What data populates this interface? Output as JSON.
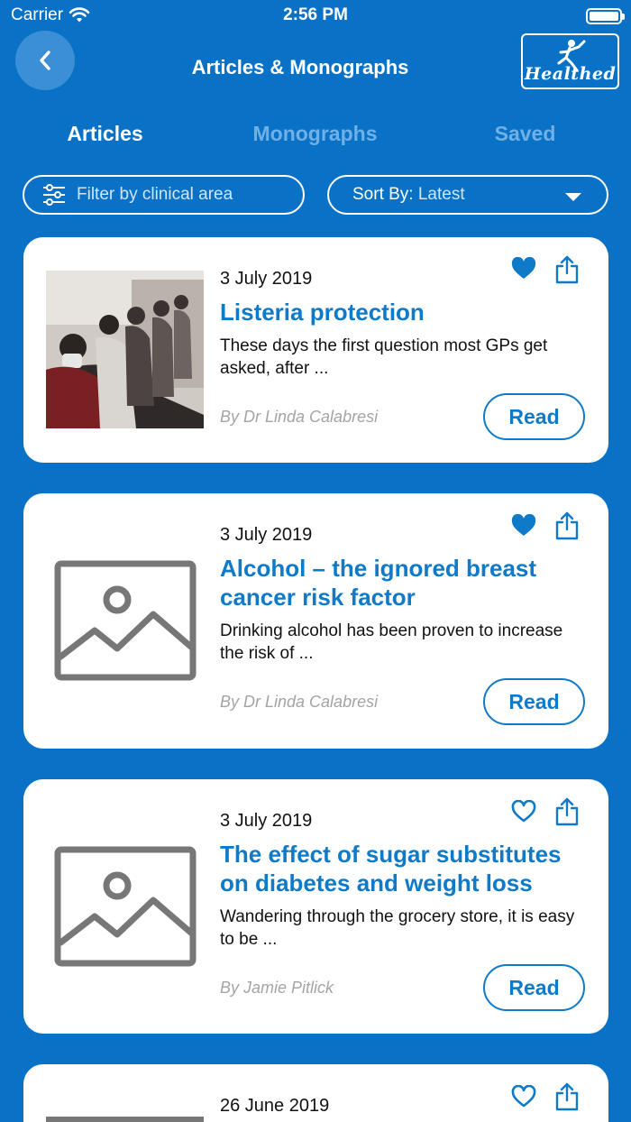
{
  "status_bar": {
    "carrier": "Carrier",
    "time": "2:56 PM"
  },
  "header": {
    "title": "Articles & Monographs",
    "logo_text": "Healthed"
  },
  "tabs": [
    {
      "label": "Articles",
      "active": true
    },
    {
      "label": "Monographs",
      "active": false
    },
    {
      "label": "Saved",
      "active": false
    }
  ],
  "filter": {
    "placeholder": "Filter by clinical area"
  },
  "sort": {
    "prefix": "Sort By:",
    "value": "Latest"
  },
  "articles": [
    {
      "date": "3 July 2019",
      "title": "Listeria protection",
      "excerpt": "These days the first question most GPs get asked, after ...",
      "author": "By Dr Linda Calabresi",
      "read_label": "Read",
      "saved": true,
      "image": "photo"
    },
    {
      "date": "3 July 2019",
      "title": "Alcohol – the ignored breast cancer risk factor",
      "excerpt": "Drinking alcohol has been proven to increase the risk of ...",
      "author": "By Dr Linda Calabresi",
      "read_label": "Read",
      "saved": true,
      "image": "placeholder"
    },
    {
      "date": "3 July 2019",
      "title": "The effect of sugar substitutes on diabetes and weight loss",
      "excerpt": "Wandering through the grocery store, it is easy to be ...",
      "author": "By Jamie Pitlick",
      "read_label": "Read",
      "saved": false,
      "image": "placeholder"
    },
    {
      "date": "26 June 2019",
      "saved": false,
      "image": "placeholder"
    }
  ],
  "colors": {
    "background": "#0a72c6",
    "accent": "#0f7ac8",
    "card": "#ffffff"
  },
  "icons": {
    "back": "chevron-left-icon",
    "filter": "sliders-icon",
    "sort": "caret-down-icon",
    "save": "heart-icon",
    "share": "share-icon",
    "placeholder": "image-placeholder-icon"
  }
}
